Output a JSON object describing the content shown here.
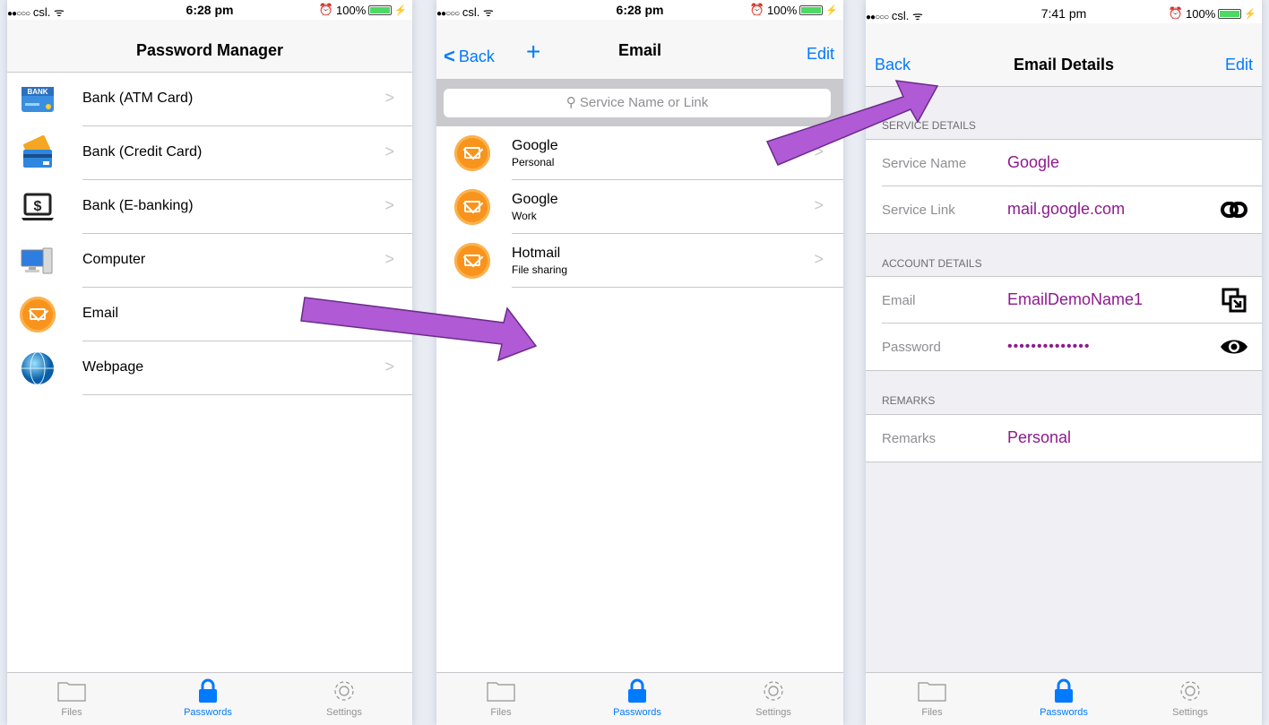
{
  "screens": {
    "s1": {
      "status": {
        "carrier": "csl.",
        "time": "6:28 pm",
        "battery": "100%"
      },
      "title": "Password Manager",
      "rows": [
        {
          "label": "Bank (ATM Card)"
        },
        {
          "label": "Bank (Credit Card)"
        },
        {
          "label": "Bank (E-banking)"
        },
        {
          "label": "Computer"
        },
        {
          "label": "Email"
        },
        {
          "label": "Webpage"
        }
      ],
      "bank_icon_text": "BANK"
    },
    "s2": {
      "status": {
        "carrier": "csl.",
        "time": "6:28 pm",
        "battery": "100%"
      },
      "back": "Back",
      "plus": "+",
      "title": "Email",
      "edit": "Edit",
      "search_placeholder": "Service Name or Link",
      "items": [
        {
          "title": "Google",
          "subtitle": "Personal"
        },
        {
          "title": "Google",
          "subtitle": "Work"
        },
        {
          "title": "Hotmail",
          "subtitle": "File sharing"
        }
      ]
    },
    "s3": {
      "status": {
        "carrier": "csl.",
        "time": "7:41 pm",
        "battery": "100%"
      },
      "back": "Back",
      "title": "Email Details",
      "edit": "Edit",
      "sections": {
        "service": "SERVICE DETAILS",
        "account": "ACCOUNT DETAILS",
        "remarks": "REMARKS"
      },
      "fields": {
        "service_name": {
          "label": "Service Name",
          "value": "Google"
        },
        "service_link": {
          "label": "Service Link",
          "value": "mail.google.com"
        },
        "email": {
          "label": "Email",
          "value": "EmailDemoName1"
        },
        "password": {
          "label": "Password",
          "value": "••••••••••••••"
        },
        "remarks": {
          "label": "Remarks",
          "value": "Personal"
        }
      }
    }
  },
  "tabbar": {
    "files": "Files",
    "passwords": "Passwords",
    "settings": "Settings"
  },
  "colors": {
    "accent": "#007aff",
    "value": "#8e1a8e",
    "arrow": "#b05ad6",
    "email_orange": "#f8941d"
  }
}
